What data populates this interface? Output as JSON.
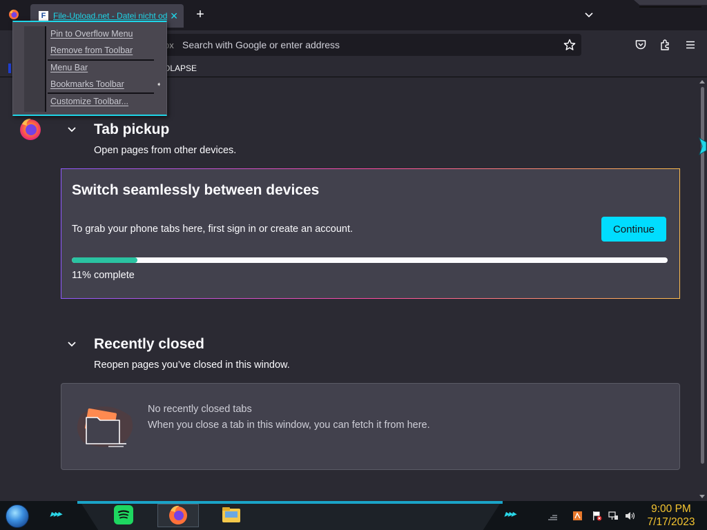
{
  "browser": {
    "tab": {
      "favicon_letter": "F",
      "title": "File-Upload.net - Datei nicht od"
    },
    "urlbar": {
      "identity_text": "ox",
      "placeholder": "Search with Google or enter address"
    },
    "bookmarks_toolbar": {
      "item_label": "OLAPSE"
    }
  },
  "context_menu": {
    "items": [
      {
        "label": "Pin to Overflow Menu"
      },
      {
        "label": "Remove from Toolbar"
      },
      {
        "label": "Menu Bar"
      },
      {
        "label": "Bookmarks Toolbar",
        "has_submenu": true
      },
      {
        "label": "Customize Toolbar..."
      }
    ]
  },
  "page": {
    "tab_pickup": {
      "title": "Tab pickup",
      "subtitle": "Open pages from other devices.",
      "card": {
        "heading": "Switch seamlessly between devices",
        "body": "To grab your phone tabs here, first sign in or create an account.",
        "button_label": "Continue",
        "progress_percent": 11,
        "progress_text": "11% complete"
      }
    },
    "recently_closed": {
      "title": "Recently closed",
      "subtitle": "Reopen pages you’ve closed in this window.",
      "empty_title": "No recently closed tabs",
      "empty_desc": "When you close a tab in this window, you can fetch it from here."
    }
  },
  "taskbar": {
    "clock_time": "9:00 PM",
    "clock_date": "7/17/2023",
    "apps": [
      "spotify-icon",
      "firefox-icon",
      "file-explorer-icon"
    ],
    "tray_icons": [
      "network-bars-icon",
      "app-tray-icon",
      "flag-alert-icon",
      "network-icon",
      "volume-icon"
    ]
  },
  "colors": {
    "accent": "#00ddff",
    "progress": "#2ac3a2",
    "background": "#2b2a33",
    "card": "#42414d",
    "tab_text": "#1fd6e8",
    "clock": "#f5c530"
  }
}
